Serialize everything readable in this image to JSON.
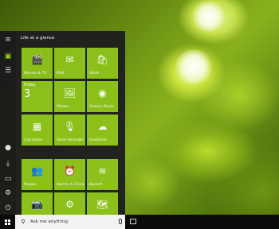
{
  "desktop": {
    "colors": {
      "wallpaper_main": "#8ab21c",
      "flower_white": "#ffffff"
    }
  },
  "start_menu": {
    "section_title": "Life at a glance",
    "accent_color": "#8cc21a",
    "rail_icons": [
      "hamburger-menu-icon",
      "tiles-view-icon",
      "all-apps-list-icon",
      "user-avatar-icon",
      "downloads-icon",
      "file-explorer-icon",
      "settings-gear-icon",
      "power-icon"
    ],
    "tiles": [
      {
        "name": "movies-tv",
        "label": "Movies & TV",
        "icon": "film-icon",
        "glyph": "🎬"
      },
      {
        "name": "mail",
        "label": "Mail",
        "icon": "mail-envelope-icon",
        "glyph": "✉"
      },
      {
        "name": "store",
        "label": "Store",
        "icon": "store-bag-icon",
        "glyph": "🛍"
      },
      {
        "name": "calendar",
        "label": "",
        "icon": "calendar-icon",
        "day": "Friday",
        "date": "3"
      },
      {
        "name": "photos",
        "label": "Photos",
        "icon": "photo-icon",
        "glyph": "🖼"
      },
      {
        "name": "groove-music",
        "label": "Groove Music",
        "icon": "music-disc-icon",
        "glyph": "◉"
      },
      {
        "name": "calculator",
        "label": "Calculator",
        "icon": "calculator-icon",
        "glyph": "▦"
      },
      {
        "name": "voice-recorder",
        "label": "Voice Recorder",
        "icon": "microphone-icon",
        "glyph": "🎙"
      },
      {
        "name": "onedrive",
        "label": "OneDrive",
        "icon": "cloud-icon",
        "glyph": "☁"
      },
      {
        "name": "people",
        "label": "People",
        "icon": "people-icon",
        "glyph": "👥"
      },
      {
        "name": "alarms-clock",
        "label": "Alarms & Clock",
        "icon": "alarm-clock-icon",
        "glyph": "⏰"
      },
      {
        "name": "bacord",
        "label": "Bacord",
        "icon": "wave-lines-icon",
        "glyph": "≋"
      },
      {
        "name": "camera",
        "label": "",
        "icon": "camera-icon",
        "glyph": "📷"
      },
      {
        "name": "settings",
        "label": "",
        "icon": "gear-icon",
        "glyph": "⚙"
      },
      {
        "name": "maps",
        "label": "",
        "icon": "map-icon",
        "glyph": "🗺"
      }
    ]
  },
  "taskbar": {
    "search_placeholder": "Ask me anything",
    "start_icon": "windows-logo-icon",
    "search_icon": "search-icon",
    "mic_icon": "microphone-icon",
    "task_view_icon": "task-view-icon"
  }
}
